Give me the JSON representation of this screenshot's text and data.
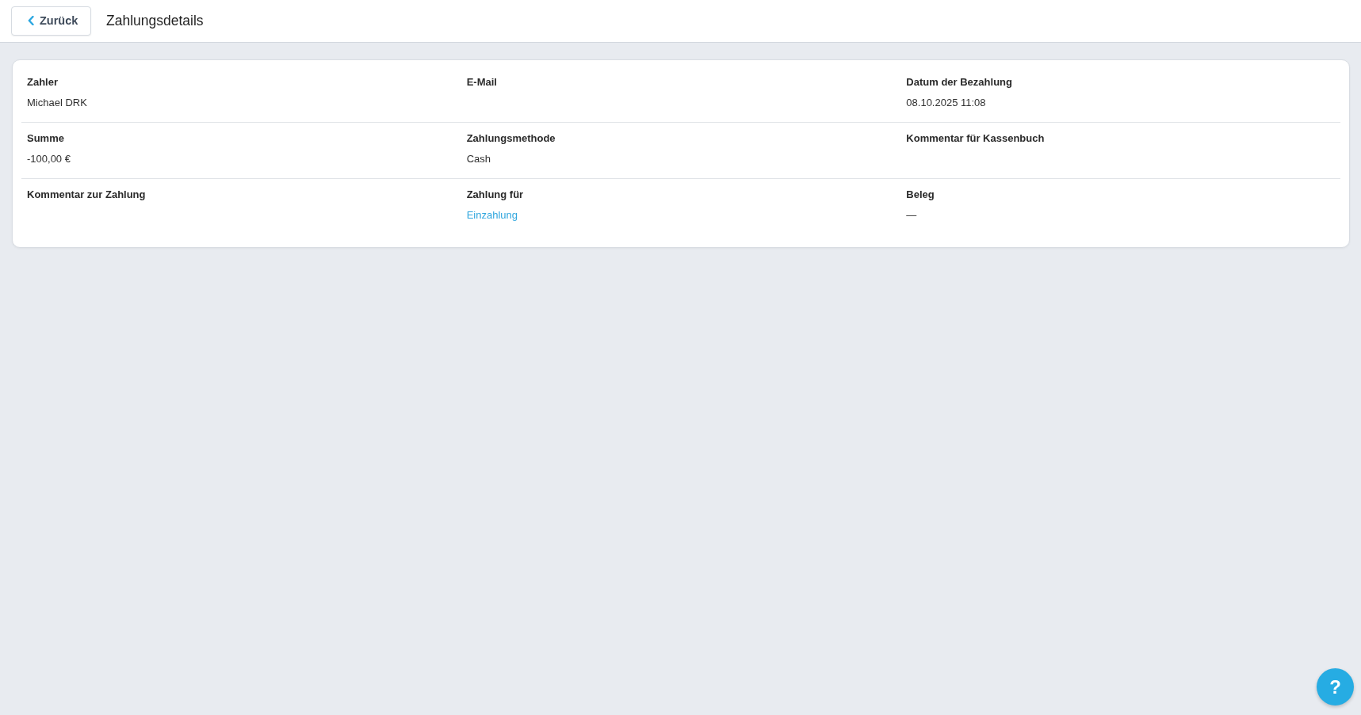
{
  "header": {
    "back_button": {
      "label": "Zurück"
    },
    "title": "Zahlungsdetails"
  },
  "details": {
    "rows": [
      {
        "fields": [
          {
            "label": "Zahler",
            "kind": "text",
            "value": "Michael DRK"
          },
          {
            "label": "E-Mail"
          },
          {
            "label": "Datum der Bezahlung",
            "kind": "text",
            "value": "08.10.2025 11:08"
          }
        ]
      },
      {
        "fields": [
          {
            "label": "Summe",
            "kind": "text",
            "value": "-100,00 €"
          },
          {
            "label": "Zahlungsmethode",
            "kind": "text",
            "value": "Cash"
          },
          {
            "label": "Kommentar für Kassenbuch"
          }
        ]
      },
      {
        "fields": [
          {
            "label": "Kommentar zur Zahlung"
          },
          {
            "label": "Zahlung für",
            "kind": "link",
            "value": "Einzahlung"
          },
          {
            "label": "Beleg",
            "kind": "text",
            "value": "—"
          }
        ]
      }
    ]
  },
  "help_button": {
    "label": "?"
  }
}
